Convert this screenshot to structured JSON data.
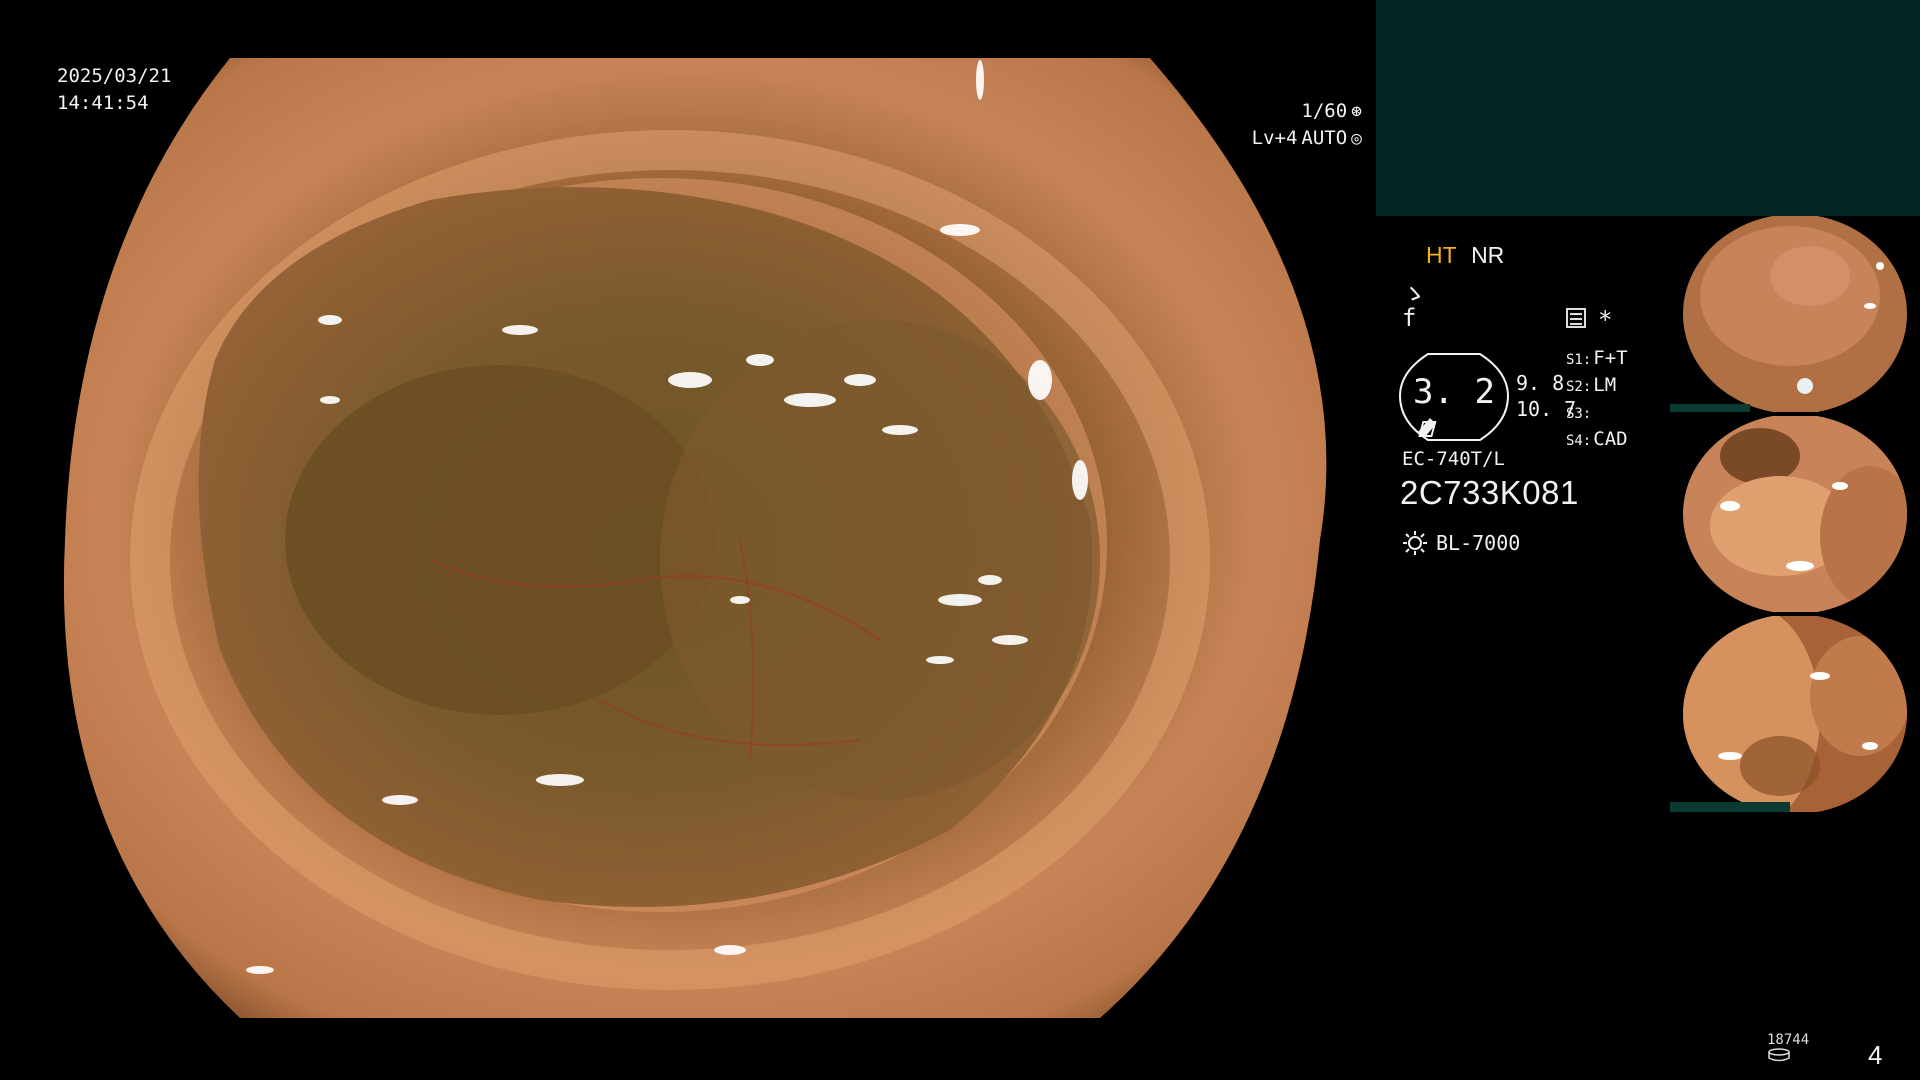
{
  "overlay": {
    "date": "2025/03/21",
    "time": "14:41:54",
    "shutter": "1/60",
    "level": "Lv+4",
    "iris": "AUTO"
  },
  "panel": {
    "mode_ht": "HT",
    "mode_nr": "NR",
    "symbol_1": "ゝ",
    "symbol_2": "f",
    "star": "*",
    "gauge_value": "3. 2",
    "gauge_sub_1": "9. 8",
    "gauge_sub_2": "10. 7",
    "settings": [
      {
        "key": "S1:",
        "value": "F+T"
      },
      {
        "key": "S2:",
        "value": "LM"
      },
      {
        "key": "S3:",
        "value": ""
      },
      {
        "key": "S4:",
        "value": "CAD"
      }
    ],
    "scope_model": "EC-740T/L",
    "scope_serial": "2C733K081",
    "light_source": "BL-7000"
  },
  "footer": {
    "counter": "18744",
    "page_number": "4"
  },
  "colors": {
    "accent_ht": "#f2b020",
    "top_panel": "#052723"
  },
  "icons": [
    "shutter-icon",
    "iris-icon",
    "menu-icon",
    "light-icon",
    "disk-icon"
  ]
}
